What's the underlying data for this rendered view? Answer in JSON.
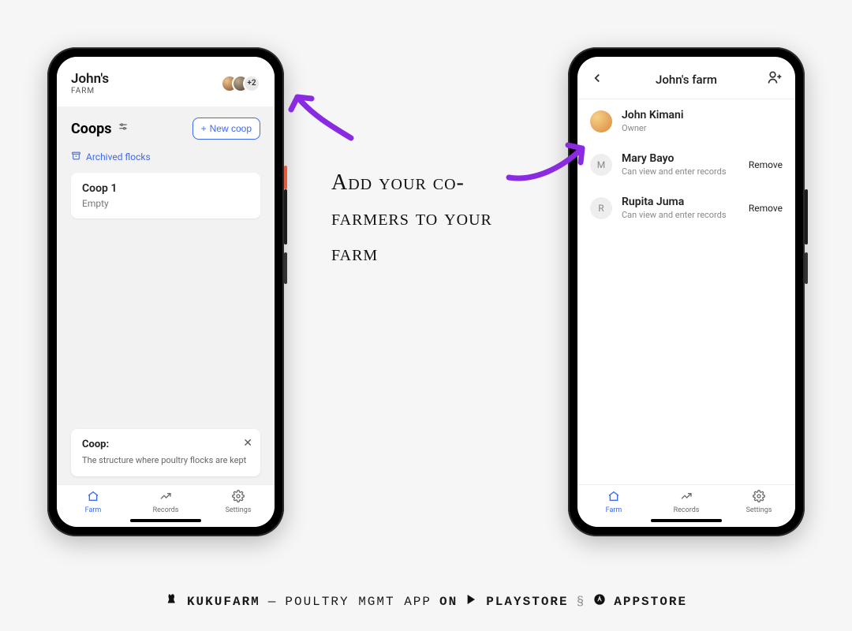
{
  "phone_left": {
    "header": {
      "title": "John's",
      "subtitle": "FARM",
      "overflow_count": "+2"
    },
    "coops": {
      "heading": "Coops",
      "new_button": "New coop",
      "archived_link": "Archived flocks",
      "items": [
        {
          "name": "Coop 1",
          "status": "Empty"
        }
      ]
    },
    "tip": {
      "title": "Coop:",
      "desc": "The structure where poultry flocks are kept"
    },
    "nav": {
      "farm": "Farm",
      "records": "Records",
      "settings": "Settings"
    }
  },
  "phone_right": {
    "header": {
      "title": "John's farm"
    },
    "members": [
      {
        "initial": "",
        "name": "John Kimani",
        "role": "Owner",
        "action": ""
      },
      {
        "initial": "M",
        "name": "Mary Bayo",
        "role": "Can view and enter records",
        "action": "Remove"
      },
      {
        "initial": "R",
        "name": "Rupita Juma",
        "role": "Can view and enter records",
        "action": "Remove"
      }
    ],
    "nav": {
      "farm": "Farm",
      "records": "Records",
      "settings": "Settings"
    }
  },
  "caption": "Add your co-farmers to your farm",
  "footer": {
    "brand": "KUKUFARM",
    "tagline": "POULTRY MGMT APP",
    "on": "ON",
    "playstore": "PLAYSTORE",
    "appstore": "APPSTORE"
  },
  "colors": {
    "accent": "#3d6af2",
    "arrow": "#8a2be2"
  }
}
